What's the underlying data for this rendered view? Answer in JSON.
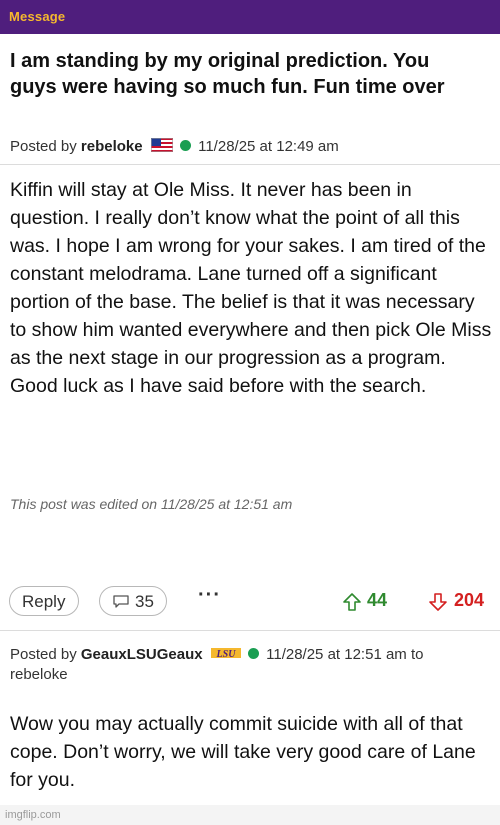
{
  "header": {
    "label": "Message"
  },
  "post": {
    "title": "I am standing by my original prediction. You guys were having so much fun. Fun time over",
    "posted_by_prefix": "Posted by",
    "author": "rebeloke",
    "timestamp": "11/28/25 at 12:49 am",
    "body": "Kiffin will stay at Ole Miss. It never has been in question. I really don’t know what the point of all this was. I hope I am wrong for your sakes. I am tired of the constant melodrama. Lane turned off a significant portion of the base. The belief is that it was necessary to show him wanted everywhere and then pick Ole Miss as the next stage in our progression as a program. Good luck as I have said before with the search.",
    "edited_note": "This post was edited on 11/28/25 at 12:51 am",
    "actions": {
      "reply_label": "Reply",
      "comment_count": "35",
      "more_label": "···",
      "upvotes": "44",
      "downvotes": "204"
    }
  },
  "reply": {
    "posted_by_prefix": "Posted by",
    "author": "GeauxLSUGeaux",
    "badge_text": "LSU",
    "timestamp": "11/28/25 at 12:51 am to",
    "reply_to": "rebeloke",
    "body": "Wow you may actually commit suicide with all of that cope. Don’t worry, we will take very good care of Lane for you."
  },
  "watermark": "imgflip.com",
  "colors": {
    "header_bg": "#4f1e7d",
    "header_text": "#f5b82e",
    "online_dot": "#1a9e52",
    "upvote": "#2f8a2f",
    "downvote": "#d42020"
  },
  "icons": [
    "us-flag-icon",
    "online-status-icon",
    "comment-bubble-icon",
    "upvote-arrow-icon",
    "downvote-arrow-icon",
    "lsu-logo-icon"
  ]
}
